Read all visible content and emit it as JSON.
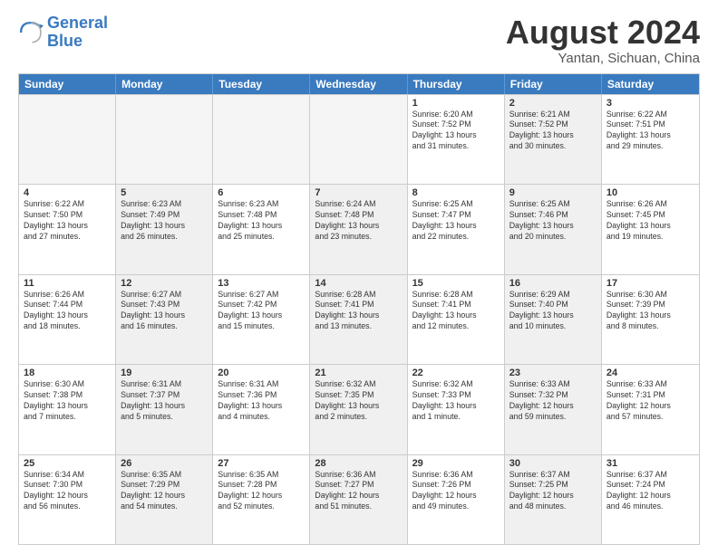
{
  "logo": {
    "line1": "General",
    "line2": "Blue"
  },
  "title": "August 2024",
  "location": "Yantan, Sichuan, China",
  "weekdays": [
    "Sunday",
    "Monday",
    "Tuesday",
    "Wednesday",
    "Thursday",
    "Friday",
    "Saturday"
  ],
  "weeks": [
    [
      {
        "day": "",
        "info": "",
        "empty": true
      },
      {
        "day": "",
        "info": "",
        "empty": true
      },
      {
        "day": "",
        "info": "",
        "empty": true
      },
      {
        "day": "",
        "info": "",
        "empty": true
      },
      {
        "day": "1",
        "info": "Sunrise: 6:20 AM\nSunset: 7:52 PM\nDaylight: 13 hours\nand 31 minutes."
      },
      {
        "day": "2",
        "info": "Sunrise: 6:21 AM\nSunset: 7:52 PM\nDaylight: 13 hours\nand 30 minutes.",
        "shaded": true
      },
      {
        "day": "3",
        "info": "Sunrise: 6:22 AM\nSunset: 7:51 PM\nDaylight: 13 hours\nand 29 minutes."
      }
    ],
    [
      {
        "day": "4",
        "info": "Sunrise: 6:22 AM\nSunset: 7:50 PM\nDaylight: 13 hours\nand 27 minutes."
      },
      {
        "day": "5",
        "info": "Sunrise: 6:23 AM\nSunset: 7:49 PM\nDaylight: 13 hours\nand 26 minutes.",
        "shaded": true
      },
      {
        "day": "6",
        "info": "Sunrise: 6:23 AM\nSunset: 7:48 PM\nDaylight: 13 hours\nand 25 minutes."
      },
      {
        "day": "7",
        "info": "Sunrise: 6:24 AM\nSunset: 7:48 PM\nDaylight: 13 hours\nand 23 minutes.",
        "shaded": true
      },
      {
        "day": "8",
        "info": "Sunrise: 6:25 AM\nSunset: 7:47 PM\nDaylight: 13 hours\nand 22 minutes."
      },
      {
        "day": "9",
        "info": "Sunrise: 6:25 AM\nSunset: 7:46 PM\nDaylight: 13 hours\nand 20 minutes.",
        "shaded": true
      },
      {
        "day": "10",
        "info": "Sunrise: 6:26 AM\nSunset: 7:45 PM\nDaylight: 13 hours\nand 19 minutes."
      }
    ],
    [
      {
        "day": "11",
        "info": "Sunrise: 6:26 AM\nSunset: 7:44 PM\nDaylight: 13 hours\nand 18 minutes."
      },
      {
        "day": "12",
        "info": "Sunrise: 6:27 AM\nSunset: 7:43 PM\nDaylight: 13 hours\nand 16 minutes.",
        "shaded": true
      },
      {
        "day": "13",
        "info": "Sunrise: 6:27 AM\nSunset: 7:42 PM\nDaylight: 13 hours\nand 15 minutes."
      },
      {
        "day": "14",
        "info": "Sunrise: 6:28 AM\nSunset: 7:41 PM\nDaylight: 13 hours\nand 13 minutes.",
        "shaded": true
      },
      {
        "day": "15",
        "info": "Sunrise: 6:28 AM\nSunset: 7:41 PM\nDaylight: 13 hours\nand 12 minutes."
      },
      {
        "day": "16",
        "info": "Sunrise: 6:29 AM\nSunset: 7:40 PM\nDaylight: 13 hours\nand 10 minutes.",
        "shaded": true
      },
      {
        "day": "17",
        "info": "Sunrise: 6:30 AM\nSunset: 7:39 PM\nDaylight: 13 hours\nand 8 minutes."
      }
    ],
    [
      {
        "day": "18",
        "info": "Sunrise: 6:30 AM\nSunset: 7:38 PM\nDaylight: 13 hours\nand 7 minutes."
      },
      {
        "day": "19",
        "info": "Sunrise: 6:31 AM\nSunset: 7:37 PM\nDaylight: 13 hours\nand 5 minutes.",
        "shaded": true
      },
      {
        "day": "20",
        "info": "Sunrise: 6:31 AM\nSunset: 7:36 PM\nDaylight: 13 hours\nand 4 minutes."
      },
      {
        "day": "21",
        "info": "Sunrise: 6:32 AM\nSunset: 7:35 PM\nDaylight: 13 hours\nand 2 minutes.",
        "shaded": true
      },
      {
        "day": "22",
        "info": "Sunrise: 6:32 AM\nSunset: 7:33 PM\nDaylight: 13 hours\nand 1 minute."
      },
      {
        "day": "23",
        "info": "Sunrise: 6:33 AM\nSunset: 7:32 PM\nDaylight: 12 hours\nand 59 minutes.",
        "shaded": true
      },
      {
        "day": "24",
        "info": "Sunrise: 6:33 AM\nSunset: 7:31 PM\nDaylight: 12 hours\nand 57 minutes."
      }
    ],
    [
      {
        "day": "25",
        "info": "Sunrise: 6:34 AM\nSunset: 7:30 PM\nDaylight: 12 hours\nand 56 minutes."
      },
      {
        "day": "26",
        "info": "Sunrise: 6:35 AM\nSunset: 7:29 PM\nDaylight: 12 hours\nand 54 minutes.",
        "shaded": true
      },
      {
        "day": "27",
        "info": "Sunrise: 6:35 AM\nSunset: 7:28 PM\nDaylight: 12 hours\nand 52 minutes."
      },
      {
        "day": "28",
        "info": "Sunrise: 6:36 AM\nSunset: 7:27 PM\nDaylight: 12 hours\nand 51 minutes.",
        "shaded": true
      },
      {
        "day": "29",
        "info": "Sunrise: 6:36 AM\nSunset: 7:26 PM\nDaylight: 12 hours\nand 49 minutes."
      },
      {
        "day": "30",
        "info": "Sunrise: 6:37 AM\nSunset: 7:25 PM\nDaylight: 12 hours\nand 48 minutes.",
        "shaded": true
      },
      {
        "day": "31",
        "info": "Sunrise: 6:37 AM\nSunset: 7:24 PM\nDaylight: 12 hours\nand 46 minutes."
      }
    ]
  ]
}
